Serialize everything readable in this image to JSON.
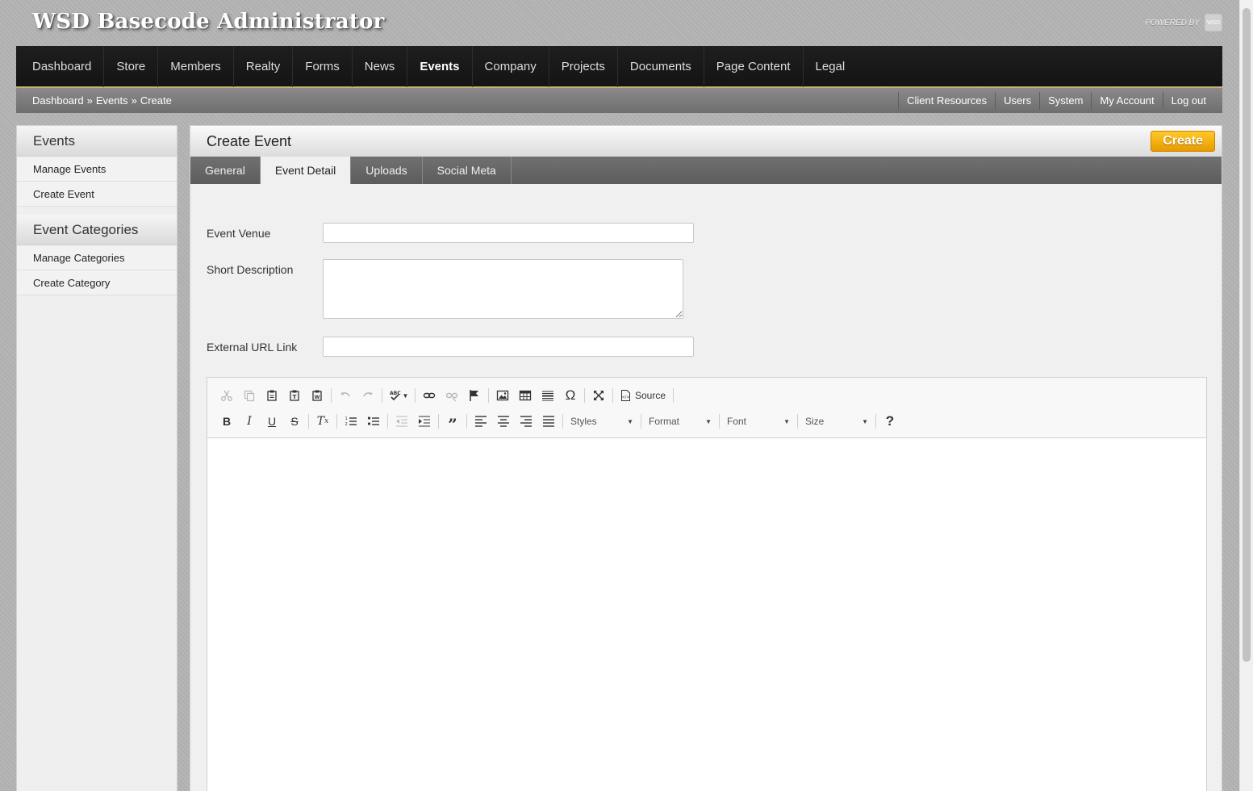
{
  "header": {
    "app_title": "WSD Basecode Administrator",
    "powered_by": "POWERED BY",
    "logo_text": "WSD"
  },
  "main_nav": {
    "items": [
      {
        "label": "Dashboard"
      },
      {
        "label": "Store"
      },
      {
        "label": "Members"
      },
      {
        "label": "Realty"
      },
      {
        "label": "Forms"
      },
      {
        "label": "News"
      },
      {
        "label": "Events"
      },
      {
        "label": "Company"
      },
      {
        "label": "Projects"
      },
      {
        "label": "Documents"
      },
      {
        "label": "Page Content"
      },
      {
        "label": "Legal"
      }
    ],
    "active": "Events",
    "accent_color": "#d9a020"
  },
  "breadcrumb": {
    "items": [
      "Dashboard",
      "Events",
      "Create"
    ],
    "separator": "»"
  },
  "util_nav": {
    "items": [
      {
        "label": "Client Resources"
      },
      {
        "label": "Users"
      },
      {
        "label": "System"
      },
      {
        "label": "My Account"
      },
      {
        "label": "Log out"
      }
    ]
  },
  "sidebar": {
    "sections": [
      {
        "title": "Events",
        "items": [
          {
            "label": "Manage Events"
          },
          {
            "label": "Create Event"
          }
        ]
      },
      {
        "title": "Event Categories",
        "items": [
          {
            "label": "Manage Categories"
          },
          {
            "label": "Create Category"
          }
        ]
      }
    ]
  },
  "main": {
    "title": "Create Event",
    "create_button": "Create",
    "create_button_color": "#f5b210",
    "tabs": [
      {
        "label": "General"
      },
      {
        "label": "Event Detail"
      },
      {
        "label": "Uploads"
      },
      {
        "label": "Social Meta"
      }
    ],
    "active_tab": "Event Detail",
    "form": {
      "event_venue": {
        "label": "Event Venue",
        "value": ""
      },
      "short_description": {
        "label": "Short Description",
        "value": ""
      },
      "external_url": {
        "label": "External URL Link",
        "value": ""
      }
    }
  },
  "editor": {
    "source_label": "Source",
    "styles_label": "Styles",
    "format_label": "Format",
    "font_label": "Font",
    "size_label": "Size",
    "help_label": "?"
  }
}
